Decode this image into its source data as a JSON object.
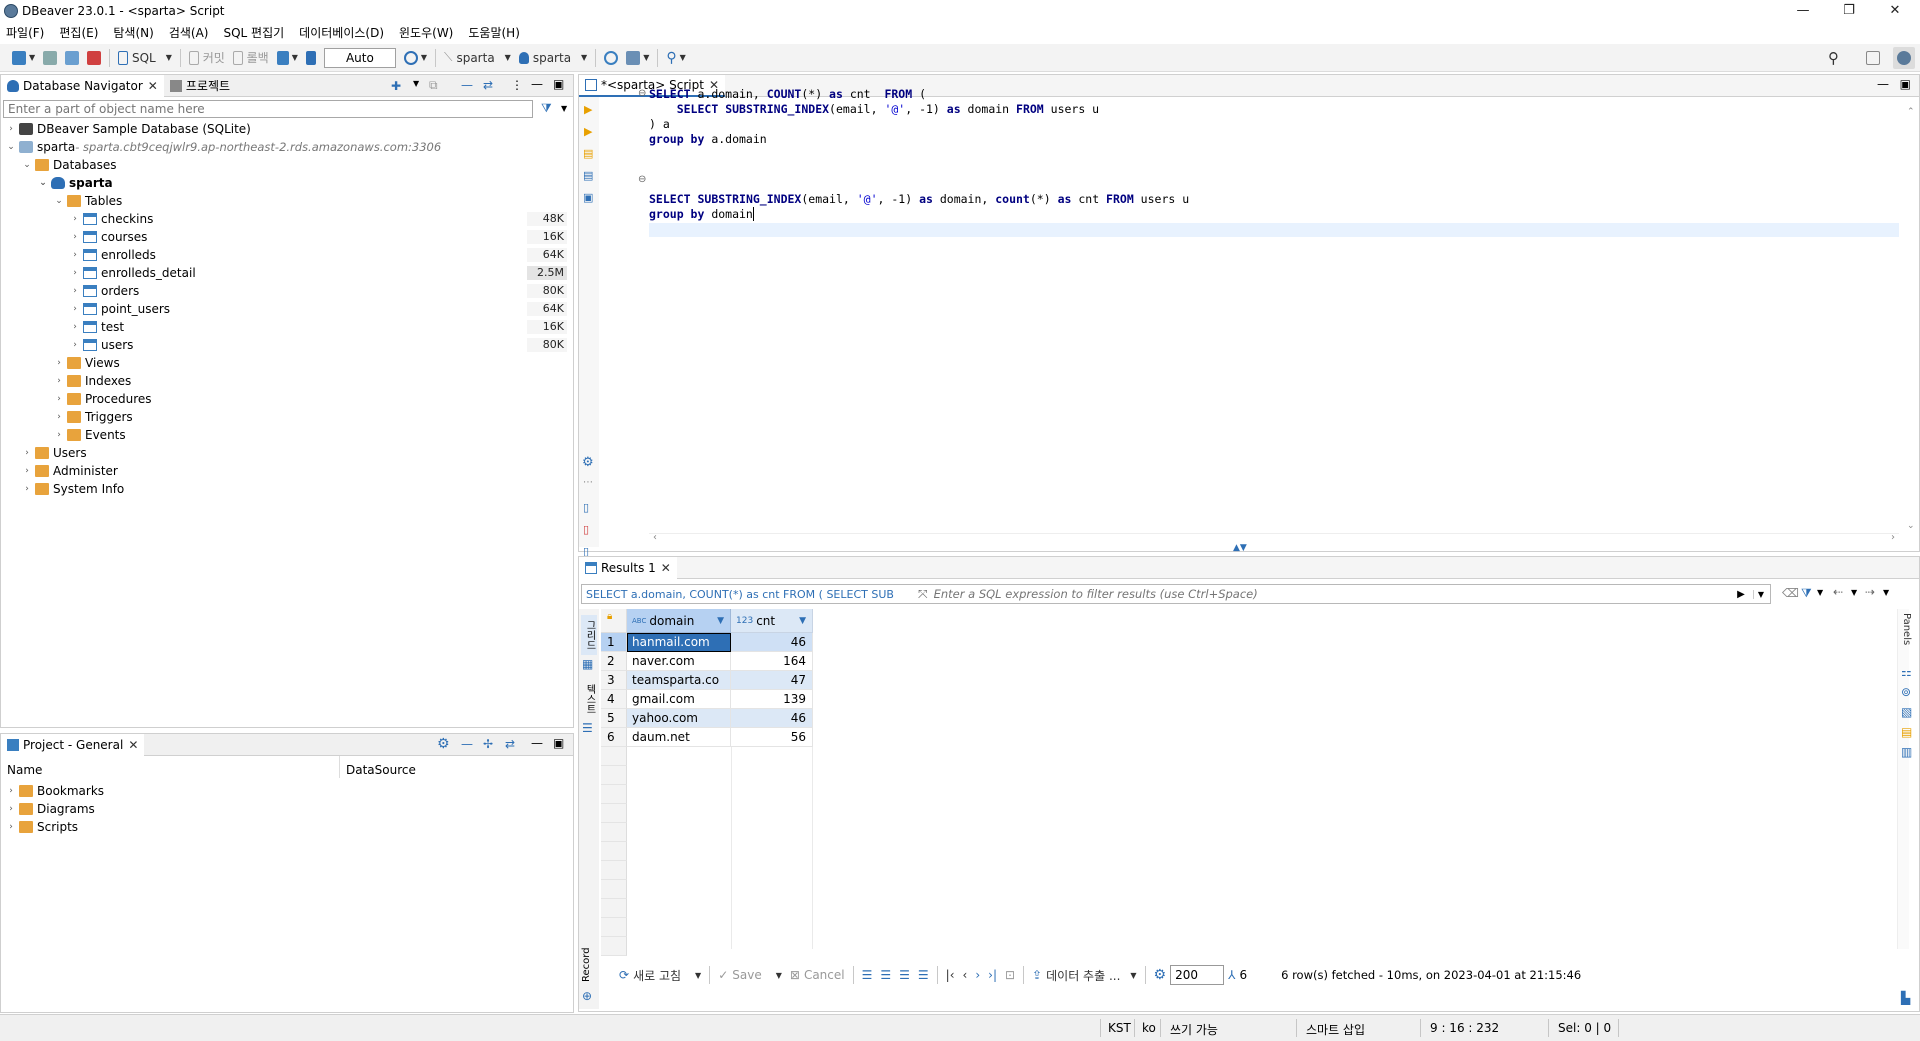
{
  "window": {
    "title": "DBeaver 23.0.1 - <sparta> Script"
  },
  "menu": [
    "파일(F)",
    "편집(E)",
    "탐색(N)",
    "검색(A)",
    "SQL 편집기",
    "데이터베이스(D)",
    "윈도우(W)",
    "도움말(H)"
  ],
  "toolbar": {
    "sql_label": "SQL",
    "commit_label": "커밋",
    "rollback_label": "롤백",
    "transaction_mode": "Auto",
    "datasource": "sparta",
    "schema": "sparta"
  },
  "navigator": {
    "tab_label": "Database Navigator",
    "project_tab_label": "프로젝트",
    "filter_placeholder": "Enter a part of object name here",
    "items": [
      {
        "label": "DBeaver Sample Database (SQLite)"
      },
      {
        "label": "sparta",
        "detail": " - sparta.cbt9ceqjwlr9.ap-northeast-2.rds.amazonaws.com:3306"
      },
      {
        "label": "Databases"
      },
      {
        "label": "sparta"
      },
      {
        "label": "Tables"
      },
      {
        "label": "Views"
      },
      {
        "label": "Indexes"
      },
      {
        "label": "Procedures"
      },
      {
        "label": "Triggers"
      },
      {
        "label": "Events"
      },
      {
        "label": "Users"
      },
      {
        "label": "Administer"
      },
      {
        "label": "System Info"
      }
    ],
    "tables": [
      {
        "name": "checkins",
        "size": "48K"
      },
      {
        "name": "courses",
        "size": "16K"
      },
      {
        "name": "enrolleds",
        "size": "64K"
      },
      {
        "name": "enrolleds_detail",
        "size": "2.5M"
      },
      {
        "name": "orders",
        "size": "80K"
      },
      {
        "name": "point_users",
        "size": "64K"
      },
      {
        "name": "test",
        "size": "16K"
      },
      {
        "name": "users",
        "size": "80K"
      }
    ]
  },
  "project": {
    "tab_label": "Project - General",
    "col_name": "Name",
    "col_datasource": "DataSource",
    "items": [
      "Bookmarks",
      "Diagrams",
      "Scripts"
    ]
  },
  "editor": {
    "tab_label": "*<sparta> Script",
    "lines": [
      "SELECT a.domain, COUNT(*) as cnt  FROM (",
      "    SELECT SUBSTRING_INDEX(email, '@', -1) as domain FROM users u",
      ") a",
      "group by a.domain",
      "",
      "",
      "",
      "SELECT SUBSTRING_INDEX(email, '@', -1) as domain, count(*) as cnt FROM users u",
      "group by domain"
    ]
  },
  "results": {
    "tab_label": "Results 1",
    "query_preview": "SELECT a.domain, COUNT(*) as cnt FROM ( SELECT SUB",
    "filter_placeholder": "Enter a SQL expression to filter results (use Ctrl+Space)",
    "columns": [
      {
        "type": "ABC",
        "name": "domain"
      },
      {
        "type": "123",
        "name": "cnt"
      }
    ],
    "rows": [
      {
        "n": "1",
        "domain": "hanmail.com",
        "cnt": "46"
      },
      {
        "n": "2",
        "domain": "naver.com",
        "cnt": "164"
      },
      {
        "n": "3",
        "domain": "teamsparta.co",
        "cnt": "47"
      },
      {
        "n": "4",
        "domain": "gmail.com",
        "cnt": "139"
      },
      {
        "n": "5",
        "domain": "yahoo.com",
        "cnt": "46"
      },
      {
        "n": "6",
        "domain": "daum.net",
        "cnt": "56"
      }
    ],
    "side_grid": "그리드",
    "side_text": "텍스트",
    "side_record": "Record",
    "panels_label": "Panels",
    "bottom": {
      "refresh": "새로 고침",
      "save": "Save",
      "cancel": "Cancel",
      "export": "데이터 추출 ...",
      "fetch_size": "200",
      "row_count": "6",
      "status": "6 row(s) fetched - 10ms, on 2023-04-01 at 21:15:46"
    }
  },
  "statusbar": {
    "tz": "KST",
    "locale": "ko",
    "mode": "쓰기 가능",
    "insert": "스마트 삽입",
    "position": "9 : 16 : 232",
    "selection": "Sel: 0 | 0"
  },
  "colors": {
    "accent": "#2e6fb5",
    "keyword": "#000080",
    "string": "#0000d0",
    "selected_row": "#cfe0f5",
    "header": "#dce8f6"
  }
}
